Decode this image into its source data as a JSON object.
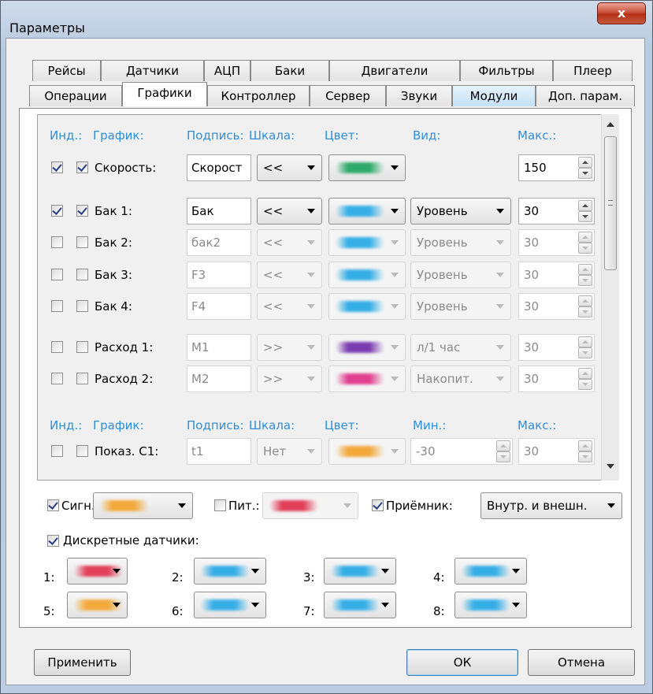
{
  "window": {
    "title": "Параметры",
    "close_glyph": "x"
  },
  "tabs_row1": [
    "Рейсы",
    "Датчики",
    "АЦП",
    "Баки",
    "Двигатели",
    "Фильтры",
    "Плеер"
  ],
  "tabs_row2": [
    "Операции",
    "Графики",
    "Контроллер",
    "Сервер",
    "Звуки",
    "Модули",
    "Доп. парам."
  ],
  "active_tab": "Графики",
  "headers1": {
    "ind": "Инд.:",
    "graph": "График:",
    "caption": "Подпись:",
    "scale": "Шкала:",
    "color": "Цвет:",
    "view": "Вид:",
    "max": "Макс.:"
  },
  "headers2": {
    "ind": "Инд.:",
    "graph": "График:",
    "caption": "Подпись:",
    "scale": "Шкала:",
    "color": "Цвет:",
    "min": "Мин.:",
    "max": "Макс.:"
  },
  "rows": [
    {
      "label": "Скорость:",
      "caption": "Скорост",
      "scale": "<<",
      "color": "#2faa6a",
      "view": "",
      "max": "150",
      "ind": true,
      "graph": true,
      "enabled": true
    },
    {
      "label": "Бак 1:",
      "caption": "Бак",
      "scale": "<<",
      "color": "#35aee6",
      "view": "Уровень",
      "max": "30",
      "ind": true,
      "graph": true,
      "enabled": true
    },
    {
      "label": "Бак 2:",
      "caption": "бак2",
      "scale": "<<",
      "color": "#35aee6",
      "view": "Уровень",
      "max": "30",
      "ind": false,
      "graph": false,
      "enabled": false
    },
    {
      "label": "Бак 3:",
      "caption": "F3",
      "scale": "<<",
      "color": "#35aee6",
      "view": "Уровень",
      "max": "30",
      "ind": false,
      "graph": false,
      "enabled": false
    },
    {
      "label": "Бак 4:",
      "caption": "F4",
      "scale": "<<",
      "color": "#35aee6",
      "view": "Уровень",
      "max": "30",
      "ind": false,
      "graph": false,
      "enabled": false
    },
    {
      "label": "Расход 1:",
      "caption": "M1",
      "scale": ">>",
      "color": "#7a3db0",
      "view": "л/1 час",
      "max": "30",
      "ind": false,
      "graph": false,
      "enabled": false
    },
    {
      "label": "Расход 2:",
      "caption": "M2",
      "scale": ">>",
      "color": "#e0408e",
      "view": "Накопит.",
      "max": "30",
      "ind": false,
      "graph": false,
      "enabled": false
    },
    {
      "label": "Показ. С1:",
      "caption": "t1",
      "scale": "Нет",
      "color": "#f2a93b",
      "min": "-30",
      "max": "30",
      "ind": false,
      "graph": false,
      "enabled": false
    }
  ],
  "bottom": {
    "signal_label": "Сигн.:",
    "signal_color": "#f2a93b",
    "signal_checked": true,
    "power_label": "Пит.:",
    "power_color": "#e0405a",
    "power_checked": false,
    "receiver_label": "Приёмник:",
    "receiver_checked": true,
    "receiver_value": "Внутр. и внешн.",
    "discrete_label": "Дискретные датчики:",
    "discrete_checked": true,
    "discrete": [
      {
        "n": "1:",
        "color": "#e0405a"
      },
      {
        "n": "2:",
        "color": "#35aee6"
      },
      {
        "n": "3:",
        "color": "#35aee6"
      },
      {
        "n": "4:",
        "color": "#35aee6"
      },
      {
        "n": "5:",
        "color": "#f2a93b"
      },
      {
        "n": "6:",
        "color": "#35aee6"
      },
      {
        "n": "7:",
        "color": "#35aee6"
      },
      {
        "n": "8:",
        "color": "#35aee6"
      }
    ]
  },
  "buttons": {
    "apply": "Применить",
    "ok": "ОК",
    "cancel": "Отмена"
  }
}
